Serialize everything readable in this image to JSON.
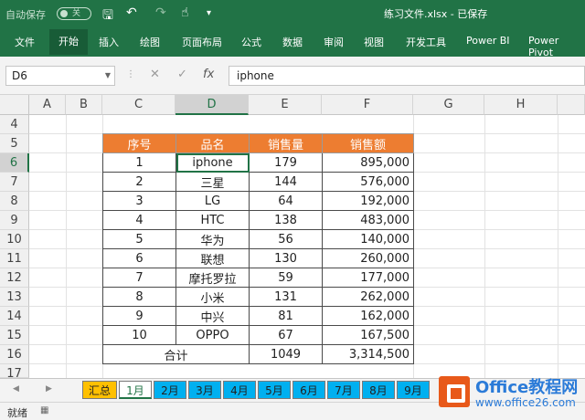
{
  "titlebar": {
    "autosave": "自动保存",
    "toggle": "关",
    "doc_title": "练习文件.xlsx  -  已保存",
    "save_icon": "save-icon",
    "undo_icon": "undo-icon",
    "redo_icon": "redo-icon"
  },
  "ribbon": {
    "tabs": [
      "文件",
      "开始",
      "插入",
      "绘图",
      "页面布局",
      "公式",
      "数据",
      "审阅",
      "视图",
      "开发工具",
      "Power BI",
      "Power Pivot"
    ],
    "active": "开始"
  },
  "formula_bar": {
    "name_box": "D6",
    "fx": "fx",
    "value": "iphone"
  },
  "columns": [
    "A",
    "B",
    "C",
    "D",
    "E",
    "F",
    "G",
    "H"
  ],
  "rows": [
    "4",
    "5",
    "6",
    "7",
    "8",
    "9",
    "10",
    "11",
    "12",
    "13",
    "14",
    "15",
    "16",
    "17"
  ],
  "table": {
    "headers": [
      "序号",
      "品名",
      "销售量",
      "销售额"
    ],
    "rows": [
      [
        "1",
        "iphone",
        "179",
        "895,000"
      ],
      [
        "2",
        "三星",
        "144",
        "576,000"
      ],
      [
        "3",
        "LG",
        "64",
        "192,000"
      ],
      [
        "4",
        "HTC",
        "138",
        "483,000"
      ],
      [
        "5",
        "华为",
        "56",
        "140,000"
      ],
      [
        "6",
        "联想",
        "130",
        "260,000"
      ],
      [
        "7",
        "摩托罗拉",
        "59",
        "177,000"
      ],
      [
        "8",
        "小米",
        "131",
        "262,000"
      ],
      [
        "9",
        "中兴",
        "81",
        "162,000"
      ],
      [
        "10",
        "OPPO",
        "67",
        "167,500"
      ]
    ],
    "total": {
      "label": "合计",
      "qty": "1049",
      "amount": "3,314,500"
    }
  },
  "sheets": [
    "汇总",
    "1月",
    "2月",
    "3月",
    "4月",
    "5月",
    "6月",
    "7月",
    "8月",
    "9月"
  ],
  "active_sheet": "1月",
  "status": {
    "ready": "就绪"
  },
  "watermark": {
    "line1": "Office教程网",
    "line2": "www.office26.com"
  },
  "colors": {
    "excel_green": "#217346",
    "header_orange": "#ed7d31",
    "tab_yellow": "#ffc000",
    "tab_blue": "#00b0f0"
  }
}
